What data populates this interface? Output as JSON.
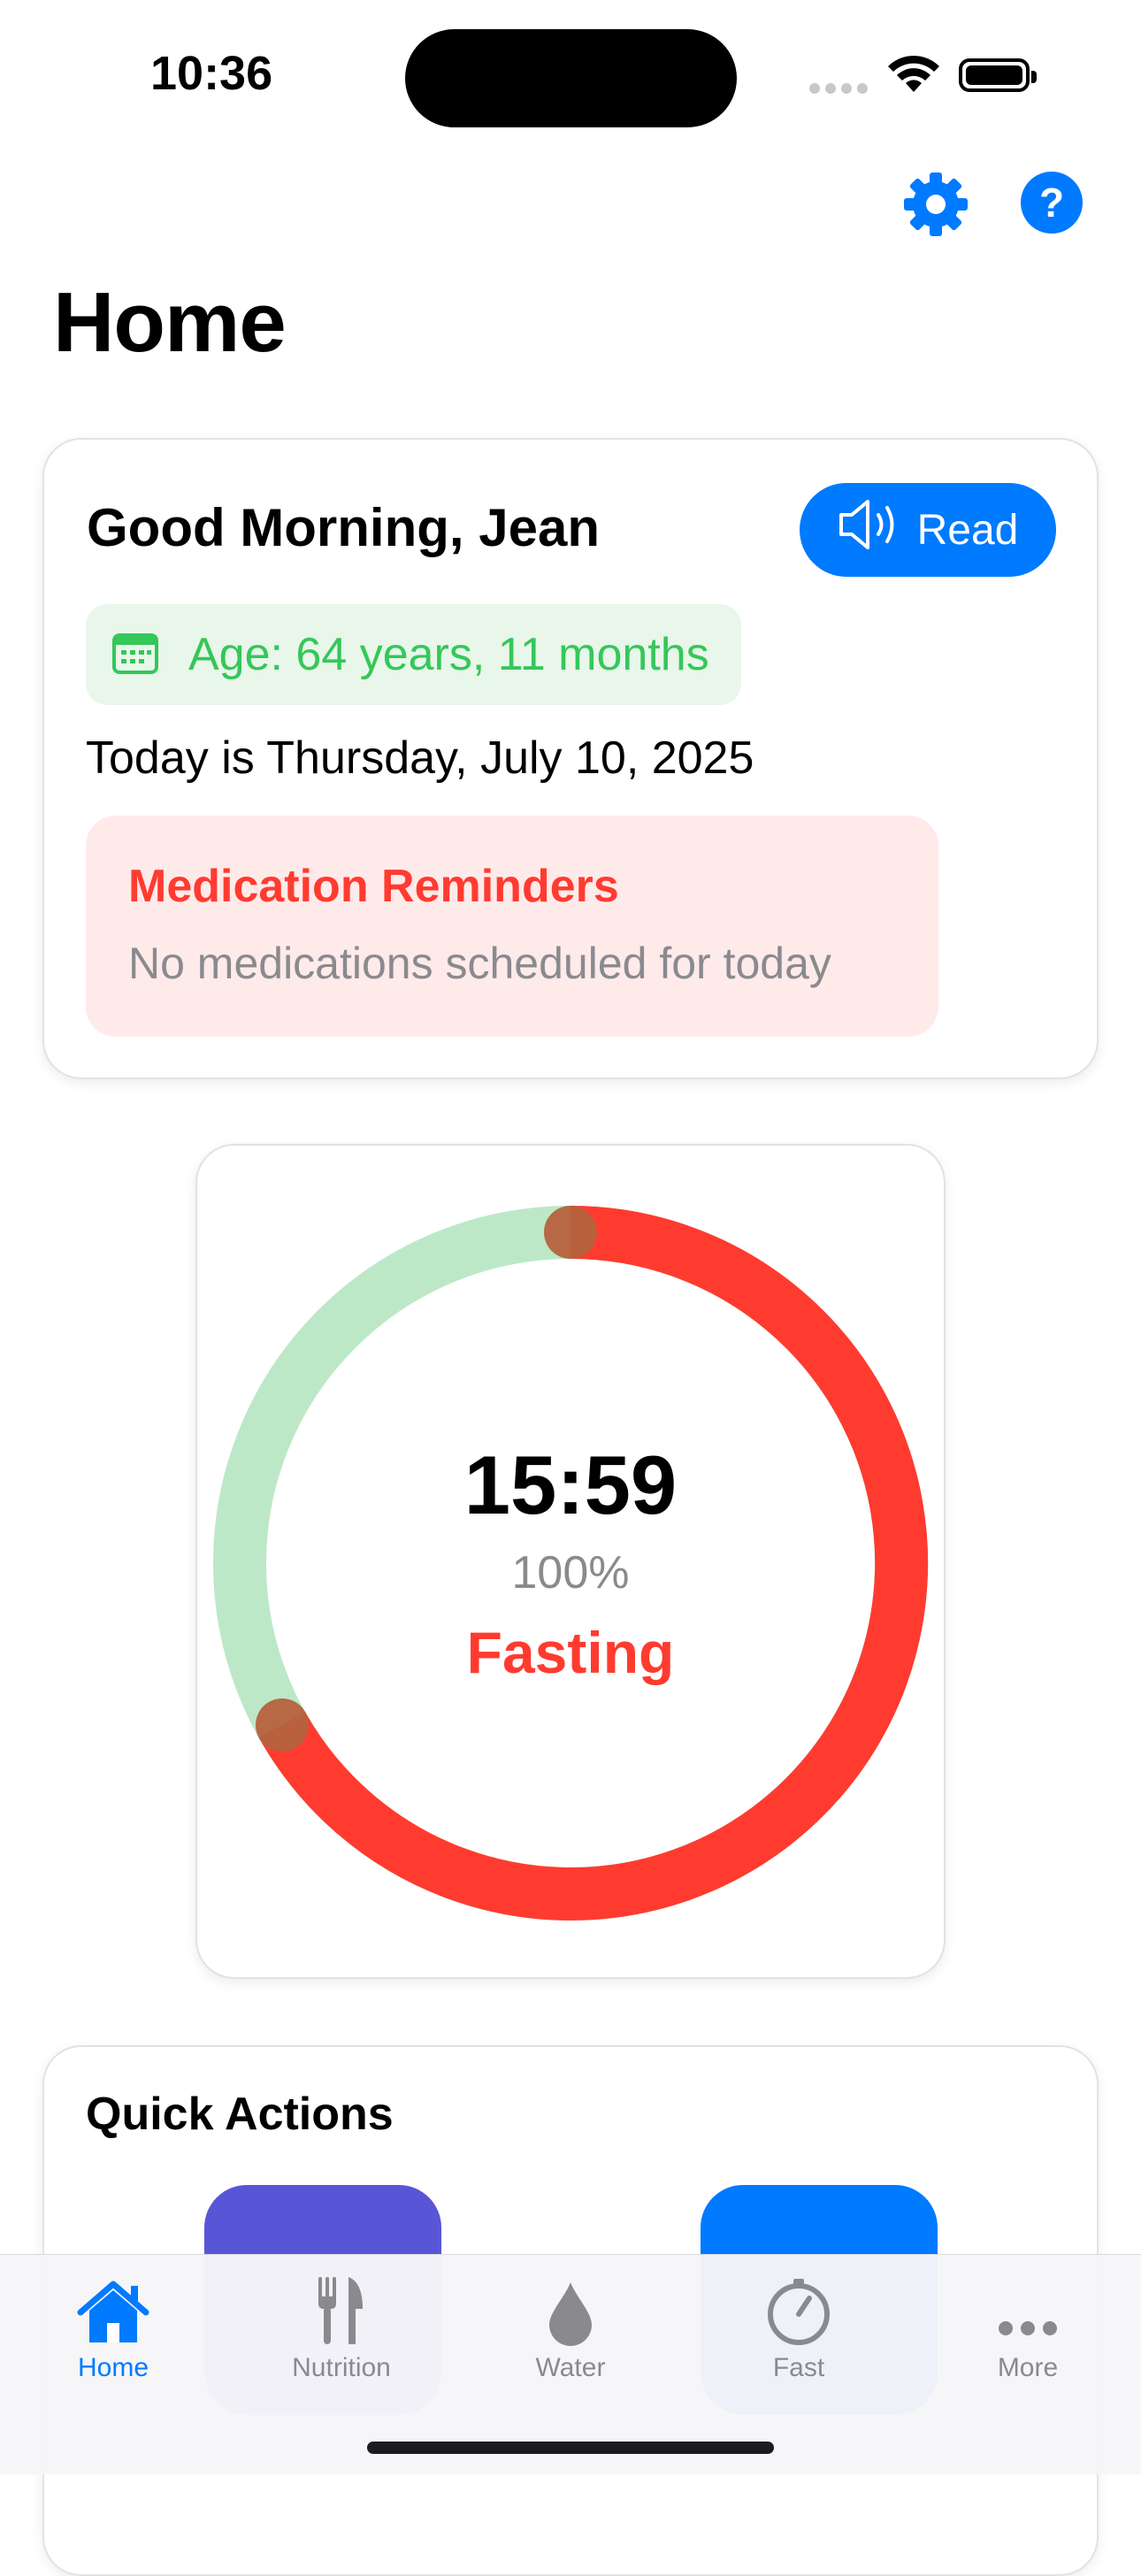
{
  "status_bar": {
    "time": "10:36"
  },
  "page": {
    "title": "Home"
  },
  "greeting_card": {
    "greeting": "Good Morning, Jean",
    "read_button": "Read",
    "age": "Age: 64 years, 11 months",
    "today": "Today is Thursday, July 10, 2025",
    "medication": {
      "title": "Medication Reminders",
      "message": "No medications scheduled for today"
    }
  },
  "fasting_timer": {
    "time": "15:59",
    "percent": "100%",
    "status": "Fasting",
    "colors": {
      "fasting": "#ff3b30",
      "eating": "#bde8c8",
      "marker": "#b5623d"
    }
  },
  "quick_actions": {
    "title": "Quick Actions",
    "tile_colors": [
      "#5856d6",
      "#007aff"
    ]
  },
  "tab_bar": {
    "tabs": [
      {
        "label": "Home",
        "icon": "house-icon",
        "active": true
      },
      {
        "label": "Nutrition",
        "icon": "fork-knife-icon"
      },
      {
        "label": "Water",
        "icon": "water-drop-icon"
      },
      {
        "label": "Fast",
        "icon": "timer-icon"
      },
      {
        "label": "More",
        "icon": "ellipsis-icon"
      }
    ]
  },
  "colors": {
    "accent": "#007aff",
    "success": "#34c759",
    "danger": "#ff3b30"
  }
}
